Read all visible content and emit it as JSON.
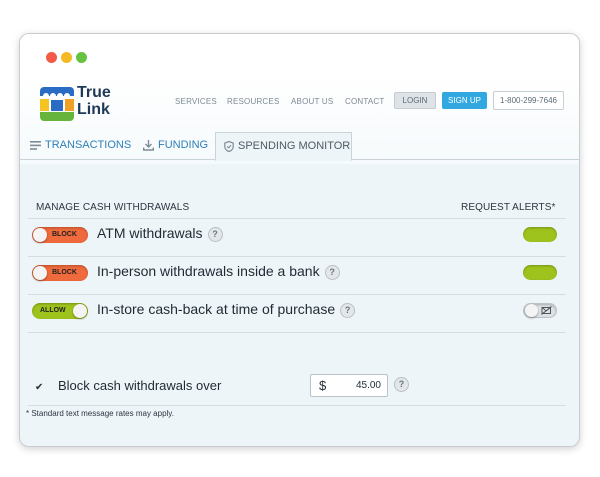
{
  "brand": {
    "line1": "True",
    "line2": "Link",
    "logo_colors": {
      "top": "#2a6cc4",
      "left": "#f5c322",
      "right": "#f0a022",
      "bottom": "#67b43c"
    }
  },
  "nav": {
    "services": "SERVICES",
    "resources": "RESOURCES",
    "about": "ABOUT US",
    "contact": "CONTACT",
    "login": "LOGIN",
    "signup": "SIGN UP",
    "phone": "1-800-299-7646"
  },
  "tabs": [
    {
      "label": "TRANSACTIONS",
      "icon": "list-icon"
    },
    {
      "label": "FUNDING",
      "icon": "download-icon"
    },
    {
      "label": "SPENDING MONITOR",
      "icon": "shield-icon"
    }
  ],
  "monitor": {
    "header_left": "MANAGE CASH WITHDRAWALS",
    "header_right": "REQUEST ALERTS*",
    "rows": [
      {
        "label": "ATM withdrawals",
        "status": "BLOCK",
        "alert_on": true
      },
      {
        "label": "In-person withdrawals inside a bank",
        "status": "BLOCK",
        "alert_on": true
      },
      {
        "label": "In-store cash-back at time of purchase",
        "status": "ALLOW",
        "alert_on": false
      }
    ],
    "help_glyph": "?",
    "check_glyph": "✔",
    "limit_label": "Block cash withdrawals over",
    "currency": "$",
    "limit_amount": "45.00",
    "footnote": "* Standard text message rates may apply."
  },
  "colors": {
    "block": "#ef6a3c",
    "allow": "#9fc31d",
    "accent": "#31a9e0",
    "tab_link": "#2f7fb6"
  }
}
